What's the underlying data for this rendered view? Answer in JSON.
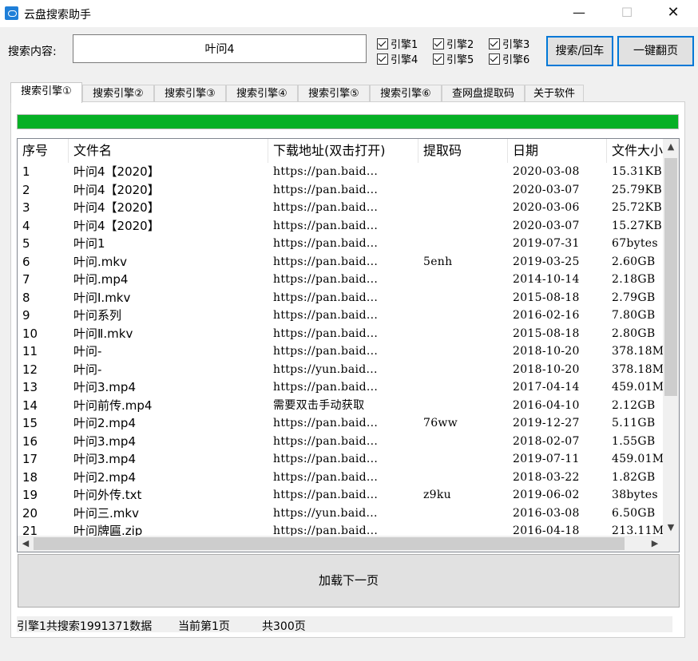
{
  "window": {
    "title": "云盘搜索助手",
    "minimize": "—",
    "maximize": "☐",
    "close": "✕"
  },
  "search": {
    "label": "搜索内容:",
    "value": "叶问4"
  },
  "engines": [
    {
      "label": "引擎1",
      "checked": true
    },
    {
      "label": "引擎2",
      "checked": true
    },
    {
      "label": "引擎3",
      "checked": true
    },
    {
      "label": "引擎4",
      "checked": true
    },
    {
      "label": "引擎5",
      "checked": true
    },
    {
      "label": "引擎6",
      "checked": true
    }
  ],
  "buttons": {
    "search": "搜索/回车",
    "next_page": "一键翻页",
    "load_next": "加载下一页"
  },
  "tabs": [
    "搜索引擎①",
    "搜索引擎②",
    "搜索引擎③",
    "搜索引擎④",
    "搜索引擎⑤",
    "搜索引擎⑥",
    "查网盘提取码",
    "关于软件"
  ],
  "progress": {
    "value": 1.0,
    "color": "#06b025"
  },
  "table": {
    "headers": [
      "序号",
      "文件名",
      "下载地址(双击打开)",
      "提取码",
      "日期",
      "文件大小"
    ],
    "rows": [
      [
        "1",
        "叶问4【2020】",
        "https://pan.baid...",
        "",
        "2020-03-08",
        "15.31KB"
      ],
      [
        "2",
        "叶问4【2020】",
        "https://pan.baid...",
        "",
        "2020-03-07",
        "25.79KB"
      ],
      [
        "3",
        "叶问4【2020】",
        "https://pan.baid...",
        "",
        "2020-03-06",
        "25.72KB"
      ],
      [
        "4",
        "叶问4【2020】",
        "https://pan.baid...",
        "",
        "2020-03-07",
        "15.27KB"
      ],
      [
        "5",
        "叶问1",
        "https://pan.baid...",
        "",
        "2019-07-31",
        "67bytes"
      ],
      [
        "6",
        "叶问.mkv",
        "https://pan.baid...",
        "5enh",
        "2019-03-25",
        "2.60GB"
      ],
      [
        "7",
        "叶问.mp4",
        "https://pan.baid...",
        "",
        "2014-10-14",
        "2.18GB"
      ],
      [
        "8",
        "叶问Ⅰ.mkv",
        "https://pan.baid...",
        "",
        "2015-08-18",
        "2.79GB"
      ],
      [
        "9",
        "叶问系列",
        "https://pan.baid...",
        "",
        "2016-02-16",
        "7.80GB"
      ],
      [
        "10",
        "叶问Ⅱ.mkv",
        "https://pan.baid...",
        "",
        "2015-08-18",
        "2.80GB"
      ],
      [
        "11",
        "叶问-",
        "https://pan.baid...",
        "",
        "2018-10-20",
        "378.18M"
      ],
      [
        "12",
        "叶问-",
        "https://yun.baid...",
        "",
        "2018-10-20",
        "378.18M"
      ],
      [
        "13",
        "叶问3.mp4",
        "https://pan.baid...",
        "",
        "2017-04-14",
        "459.01M"
      ],
      [
        "14",
        "叶问前传.mp4",
        "需要双击手动获取",
        "",
        "2016-04-10",
        "2.12GB"
      ],
      [
        "15",
        "叶问2.mp4",
        "https://pan.baid...",
        "76ww",
        "2019-12-27",
        "5.11GB"
      ],
      [
        "16",
        "叶问3.mp4",
        "https://pan.baid...",
        "",
        "2018-02-07",
        "1.55GB"
      ],
      [
        "17",
        "叶问3.mp4",
        "https://pan.baid...",
        "",
        "2019-07-11",
        "459.01M"
      ],
      [
        "18",
        "叶问2.mp4",
        "https://pan.baid...",
        "",
        "2018-03-22",
        "1.82GB"
      ],
      [
        "19",
        "叶问外传.txt",
        "https://pan.baid...",
        "z9ku",
        "2019-06-02",
        "38bytes"
      ],
      [
        "20",
        "叶问三.mkv",
        "https://yun.baid...",
        "",
        "2016-03-08",
        "6.50GB"
      ],
      [
        "21",
        "叶问牌匾.zip",
        "https://pan.baid...",
        "",
        "2016-04-18",
        "213.11M"
      ]
    ]
  },
  "status": {
    "engine_count": "引擎1共搜索1991371数据",
    "current_page": "当前第1页",
    "total_pages": "共300页"
  },
  "icons": {
    "app": "cloud-search-icon",
    "scroll_up": "▲",
    "scroll_down": "▼",
    "scroll_left": "◀",
    "scroll_right": "▶"
  }
}
